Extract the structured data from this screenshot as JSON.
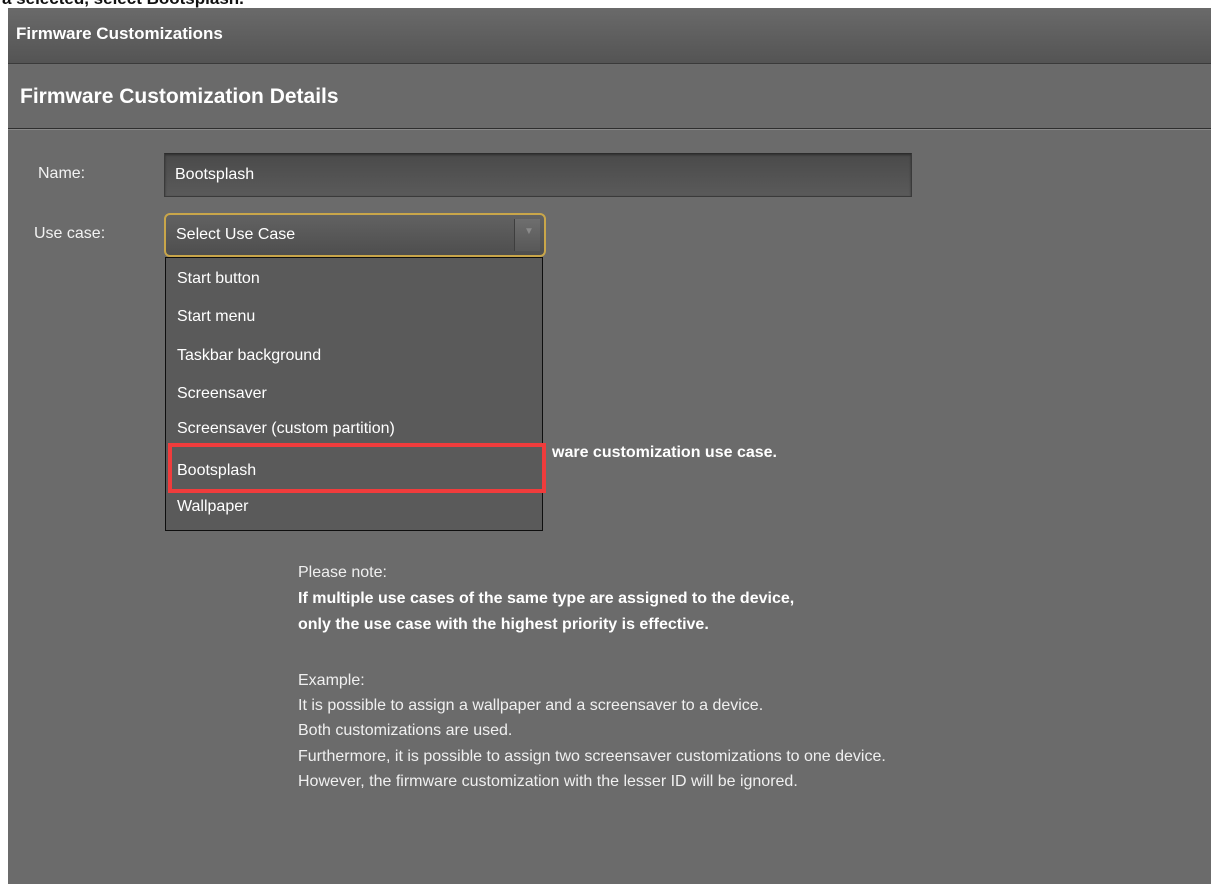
{
  "top_strip": {
    "text": "a selected, select Bootsplash."
  },
  "window": {
    "title": "Firmware Customizations"
  },
  "details": {
    "heading": "Firmware Customization Details"
  },
  "form": {
    "name_label": "Name:",
    "name_value": "Bootsplash",
    "usecase_label": "Use case:",
    "usecase_selected": "Select Use Case",
    "dropdown_arrow": "▼"
  },
  "dropdown": {
    "items": [
      "Start button",
      "Start menu",
      "Taskbar background",
      "Screensaver",
      "Screensaver (custom partition)",
      "Bootsplash",
      "Wallpaper"
    ],
    "highlighted_item": "Bootsplash",
    "highlight_color": "#f03c3c"
  },
  "hint": {
    "text": "ware customization use case."
  },
  "note": {
    "label": "Please note:",
    "bold_line1": "If multiple use cases of the same type are assigned to the device,",
    "bold_line2": "only the use case with the highest priority is effective.",
    "example_label": "Example:",
    "example_line1": "It is possible to assign a wallpaper and a screensaver to a device.",
    "example_line2": "Both customizations are used.",
    "example_line3": "Furthermore, it is possible to assign two screensaver customizations to one device.",
    "example_line4": "However, the firmware customization with the lesser ID will be ignored."
  },
  "colors": {
    "panel_bg": "#6b6b6b",
    "select_border": "#c9a64a"
  }
}
